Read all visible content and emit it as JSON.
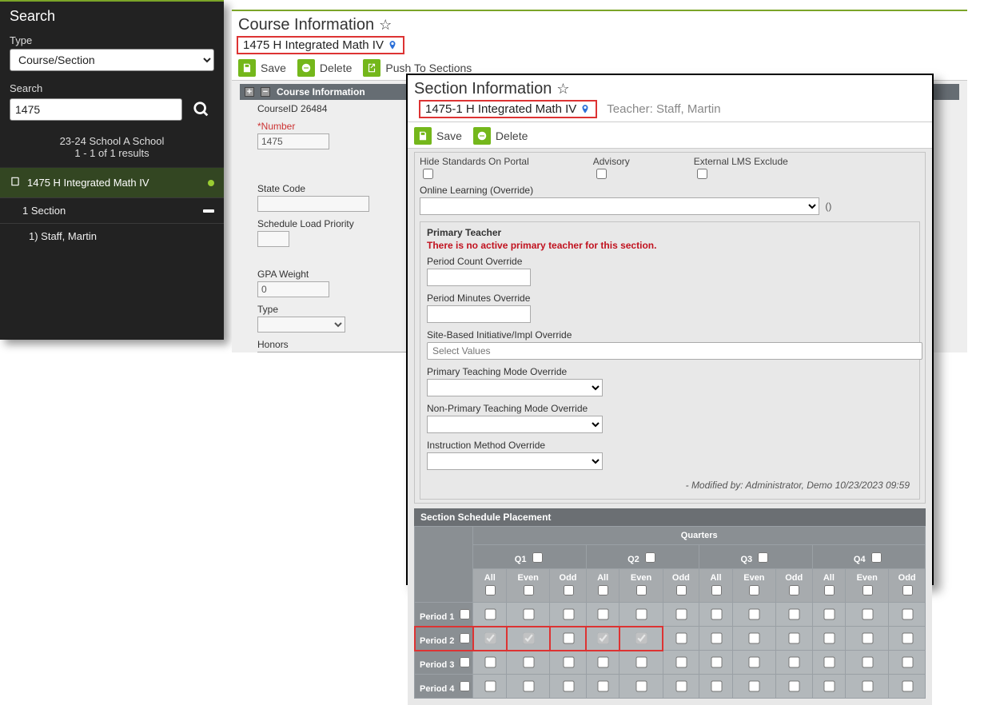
{
  "sidebar": {
    "title": "Search",
    "type_label": "Type",
    "type_value": "Course/Section",
    "search_label": "Search",
    "search_value": "1475",
    "summary_line1": "23-24 School A School",
    "summary_line2": "1 - 1 of 1 results",
    "result_course": "1475 H Integrated Math IV",
    "sub_section": "1 Section",
    "sub_teacher": "1) Staff, Martin"
  },
  "course": {
    "title": "Course Information",
    "subtitle": "1475 H Integrated Math IV",
    "toolbar": {
      "save": "Save",
      "delete": "Delete",
      "push": "Push To Sections"
    },
    "section_label": "Course Information",
    "course_id_lbl": "CourseID 26484",
    "number_lbl": "*Number",
    "number_val": "1475",
    "state_code_lbl": "State Code",
    "sched_lbl": "Schedule Load Priority",
    "gpa_lbl": "GPA Weight",
    "gpa_val": "0",
    "type_lbl": "Type",
    "honors_lbl": "Honors"
  },
  "section": {
    "title": "Section Information",
    "subtitle": "1475-1 H Integrated Math IV",
    "teacher": "Teacher: Staff, Martin",
    "toolbar": {
      "save": "Save",
      "delete": "Delete"
    },
    "hide_lbl": "Hide Standards On Portal",
    "advisory_lbl": "Advisory",
    "lms_lbl": "External LMS Exclude",
    "online_lbl": "Online Learning (Override)",
    "paren": "()",
    "primary_heading": "Primary Teacher",
    "primary_warn": "There is no active primary teacher for this section.",
    "pco_lbl": "Period Count Override",
    "pmo_lbl": "Period Minutes Override",
    "sbi_lbl": "Site-Based Initiative/Impl Override",
    "sbi_placeholder": "Select Values",
    "ptm_lbl": "Primary Teaching Mode Override",
    "nptm_lbl": "Non-Primary Teaching Mode Override",
    "imo_lbl": "Instruction Method Override",
    "modified": "- Modified by: Administrator, Demo 10/23/2023 09:59",
    "ssp_title": "Section Schedule Placement",
    "quarters_lbl": "Quarters",
    "q_labels": [
      "Q1",
      "Q2",
      "Q3",
      "Q4"
    ],
    "col_labels": [
      "All",
      "Even",
      "Odd"
    ],
    "periods": [
      "Period 1",
      "Period 2",
      "Period 3",
      "Period 4"
    ],
    "checked_row": 1,
    "checked_cells": [
      "r1_q0_all",
      "r1_q0_even",
      "r1_q1_all",
      "r1_q1_even"
    ]
  }
}
